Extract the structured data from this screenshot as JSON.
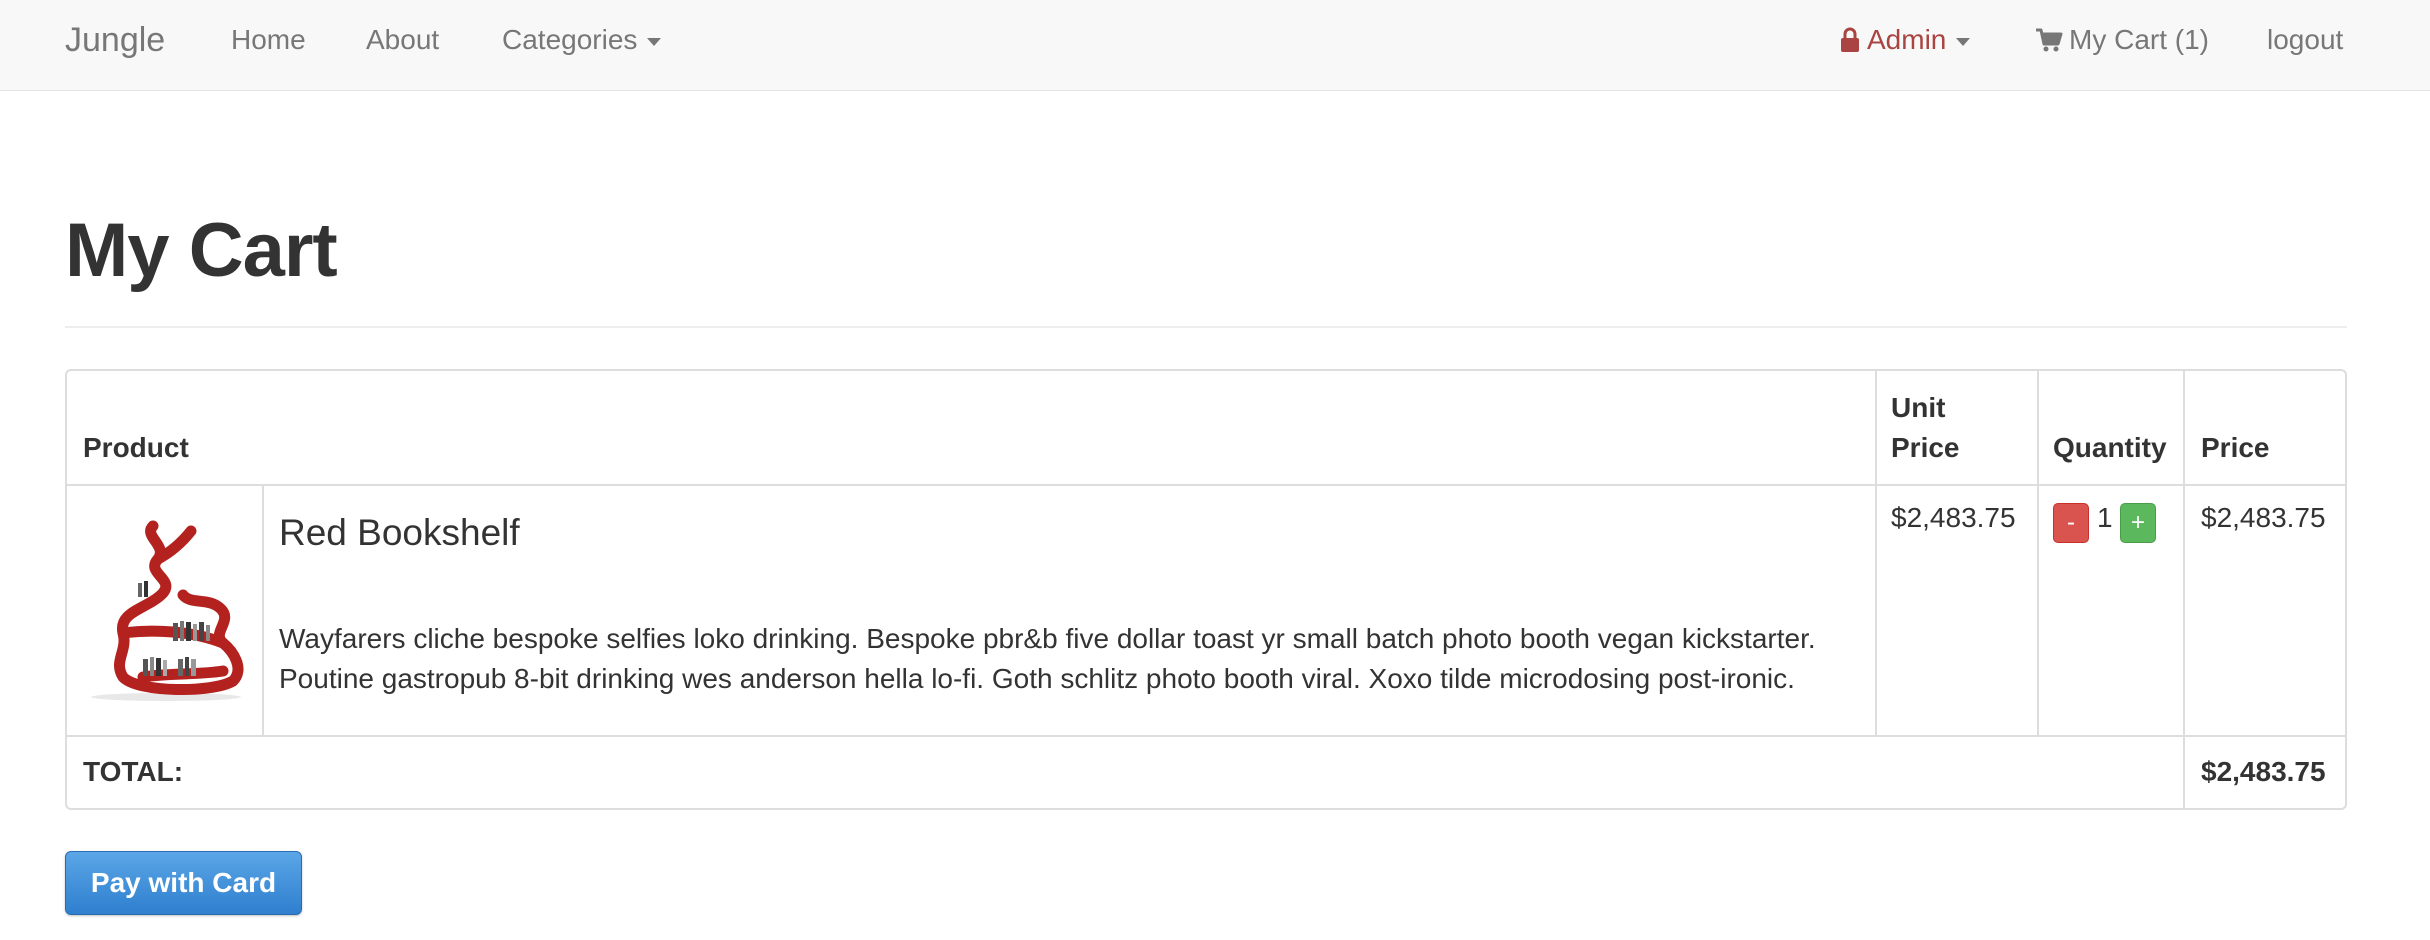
{
  "navbar": {
    "brand": "Jungle",
    "links": {
      "home": "Home",
      "about": "About",
      "categories": "Categories"
    },
    "admin": "Admin",
    "cart": "My Cart (1)",
    "logout": "logout"
  },
  "page": {
    "title": "My Cart"
  },
  "table": {
    "headers": {
      "product": "Product",
      "unit_price_line1": "Unit",
      "unit_price_line2": "Price",
      "quantity": "Quantity",
      "price": "Price"
    },
    "rows": [
      {
        "name": "Red Bookshelf",
        "description": "Wayfarers cliche bespoke selfies loko drinking. Bespoke pbr&b five dollar toast yr small batch photo booth vegan kickstarter. Poutine gastropub 8-bit drinking wes anderson hella lo-fi. Goth schlitz photo booth viral. Xoxo tilde microdosing post-ironic.",
        "unit_price": "$2,483.75",
        "quantity": "1",
        "minus_label": "-",
        "plus_label": "+",
        "price": "$2,483.75"
      }
    ],
    "total_label": "TOTAL:",
    "total_value": "$2,483.75"
  },
  "actions": {
    "pay": "Pay with Card"
  },
  "colors": {
    "admin": "#a94442",
    "minus_button": "#d9534f",
    "plus_button": "#5cb85c",
    "pay_button": "#3b8fd9"
  }
}
